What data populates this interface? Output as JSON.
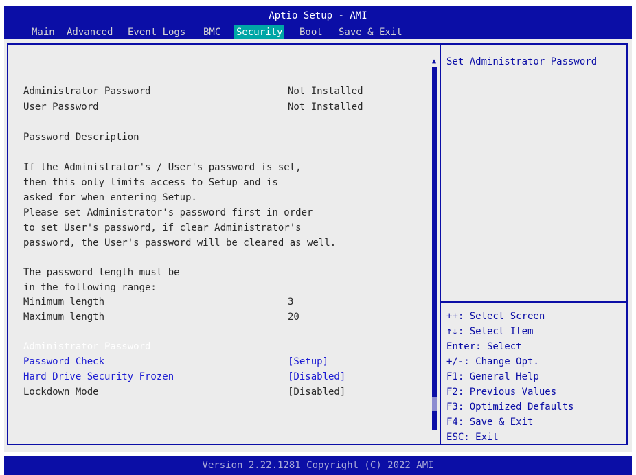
{
  "app": {
    "title": "Aptio Setup - AMI"
  },
  "tabs": [
    {
      "label": "Main",
      "active": false
    },
    {
      "label": "Advanced",
      "active": false
    },
    {
      "label": "Event Logs",
      "active": false
    },
    {
      "label": "BMC",
      "active": false
    },
    {
      "label": "Security",
      "active": true
    },
    {
      "label": "Boot",
      "active": false
    },
    {
      "label": "Save & Exit",
      "active": false
    }
  ],
  "main": {
    "admin_password": {
      "label": "Administrator Password",
      "value": "Not Installed"
    },
    "user_password": {
      "label": "User Password",
      "value": "Not Installed"
    },
    "description_heading": "Password Description",
    "description_lines": [
      "If the Administrator's / User's password is set,",
      "then this only limits access to Setup and is",
      "asked for when entering Setup.",
      "Please set Administrator's password first in order",
      "to set User's password, if clear Administrator's",
      "password, the User's password will be cleared as well."
    ],
    "length_lines": [
      "The password length must be",
      "in the following range:"
    ],
    "min_length": {
      "label": "Minimum length",
      "value": "3"
    },
    "max_length": {
      "label": "Maximum length",
      "value": "20"
    },
    "settings": [
      {
        "label": "Administrator Password",
        "value": ""
      },
      {
        "label": "Password Check",
        "value": "[Setup]"
      },
      {
        "label": "Hard Drive Security Frozen",
        "value": "[Disabled]"
      },
      {
        "label": "Lockdown Mode",
        "value": "[Disabled]"
      }
    ]
  },
  "help": {
    "title": "Set Administrator Password",
    "keys": [
      "++: Select Screen",
      "↑↓: Select Item",
      "Enter: Select",
      "+/-: Change Opt.",
      "F1: General Help",
      "F2: Previous Values",
      "F3: Optimized Defaults",
      "F4: Save & Exit",
      "ESC: Exit"
    ]
  },
  "footer": {
    "text": "Version 2.22.1281 Copyright (C) 2022 AMI"
  },
  "colors": {
    "bar": "#0b0ea6",
    "active_tab": "#00a6a6",
    "panel": "#ececec"
  }
}
